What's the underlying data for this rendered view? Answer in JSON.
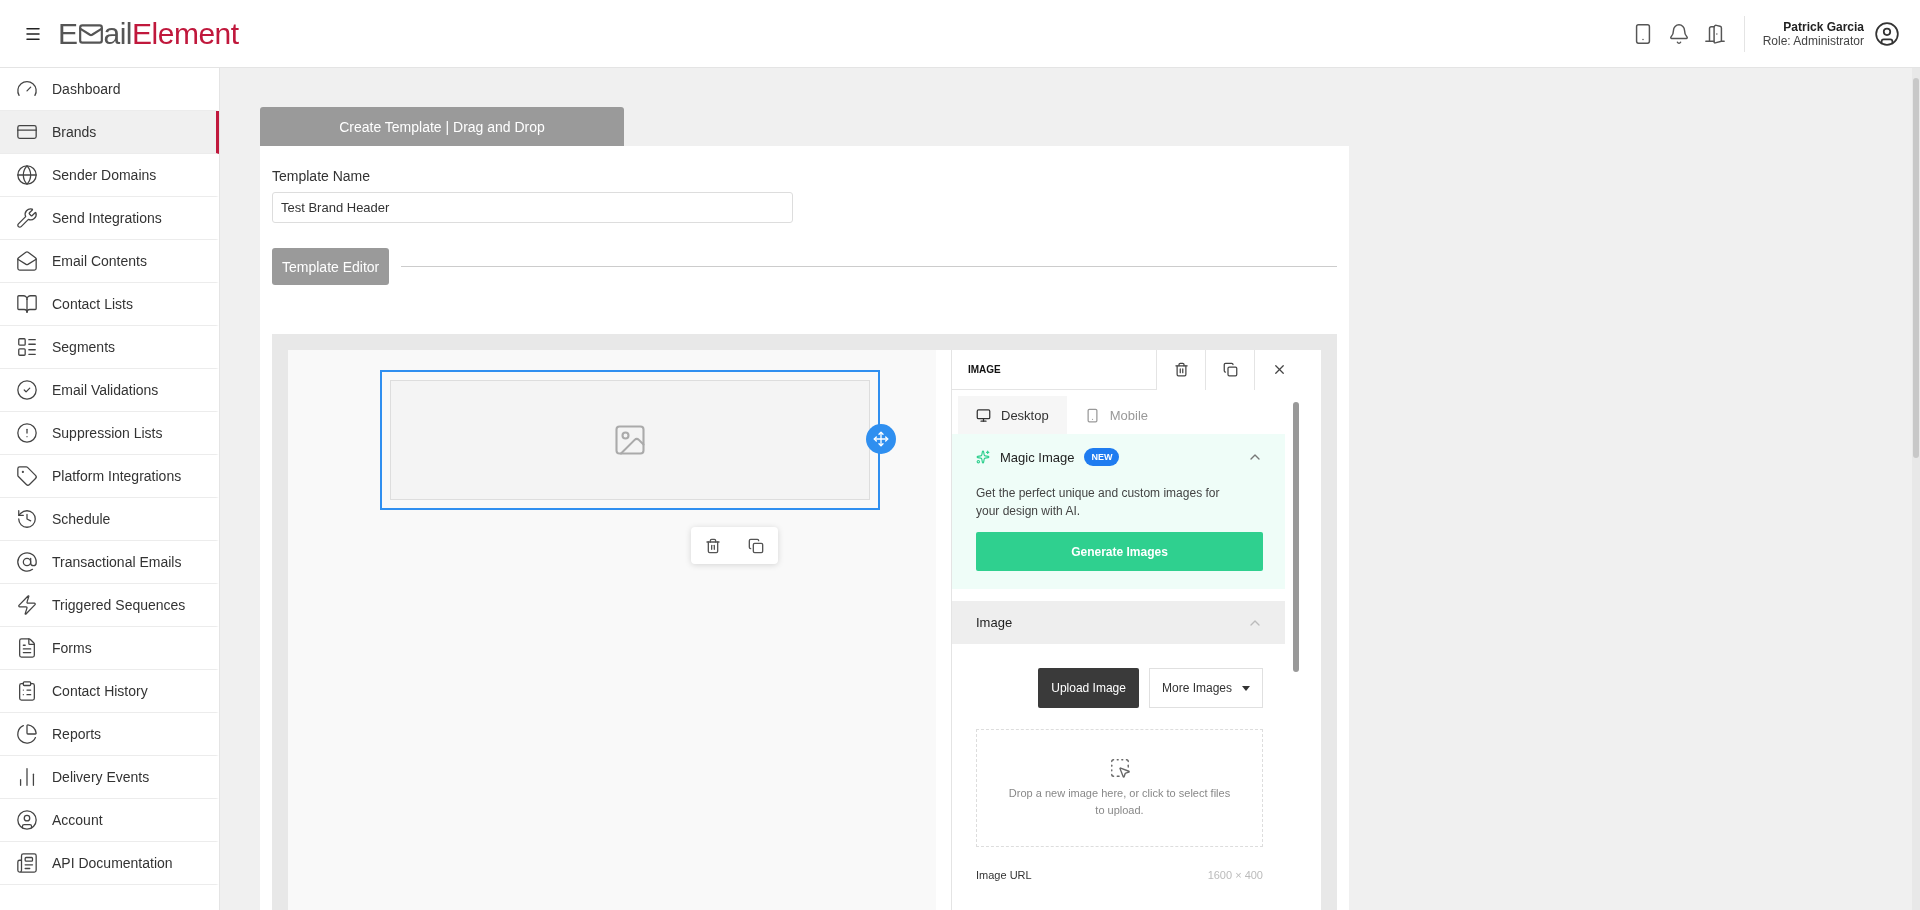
{
  "header": {
    "logo": {
      "lead": "E",
      "rest": "ail",
      "accent": "Element"
    },
    "user": {
      "name": "Patrick Garcia",
      "role": "Role: Administrator"
    }
  },
  "sidebar": {
    "items": [
      {
        "label": "Dashboard",
        "selected": false
      },
      {
        "label": "Brands",
        "selected": true
      },
      {
        "label": "Sender Domains",
        "selected": false
      },
      {
        "label": "Send Integrations",
        "selected": false
      },
      {
        "label": "Email Contents",
        "selected": false
      },
      {
        "label": "Contact Lists",
        "selected": false
      },
      {
        "label": "Segments",
        "selected": false
      },
      {
        "label": "Email Validations",
        "selected": false
      },
      {
        "label": "Suppression Lists",
        "selected": false
      },
      {
        "label": "Platform Integrations",
        "selected": false
      },
      {
        "label": "Schedule",
        "selected": false
      },
      {
        "label": "Transactional Emails",
        "selected": false
      },
      {
        "label": "Triggered Sequences",
        "selected": false
      },
      {
        "label": "Forms",
        "selected": false
      },
      {
        "label": "Contact History",
        "selected": false
      },
      {
        "label": "Reports",
        "selected": false
      },
      {
        "label": "Delivery Events",
        "selected": false
      },
      {
        "label": "Account",
        "selected": false
      },
      {
        "label": "API Documentation",
        "selected": false
      }
    ]
  },
  "page": {
    "tab": "Create Template | Drag and Drop",
    "template_name": {
      "label": "Template Name",
      "value": "Test Brand Header"
    },
    "editor_button": "Template Editor"
  },
  "editor": {
    "panel": {
      "title": "IMAGE",
      "tabs": [
        {
          "label": "Desktop",
          "selected": true
        },
        {
          "label": "Mobile",
          "selected": false
        }
      ],
      "magic": {
        "title": "Magic Image",
        "badge": "NEW",
        "expanded": true,
        "description": "Get the perfect unique and custom images for your design with AI.",
        "button": "Generate Images"
      },
      "image": {
        "title": "Image",
        "expanded": true,
        "upload_button": "Upload Image",
        "more_button": "More Images",
        "drop_text": "Drop a new image here, or click to select files to upload.",
        "url_label": "Image URL",
        "dimensions": "1600 × 400"
      }
    }
  }
}
